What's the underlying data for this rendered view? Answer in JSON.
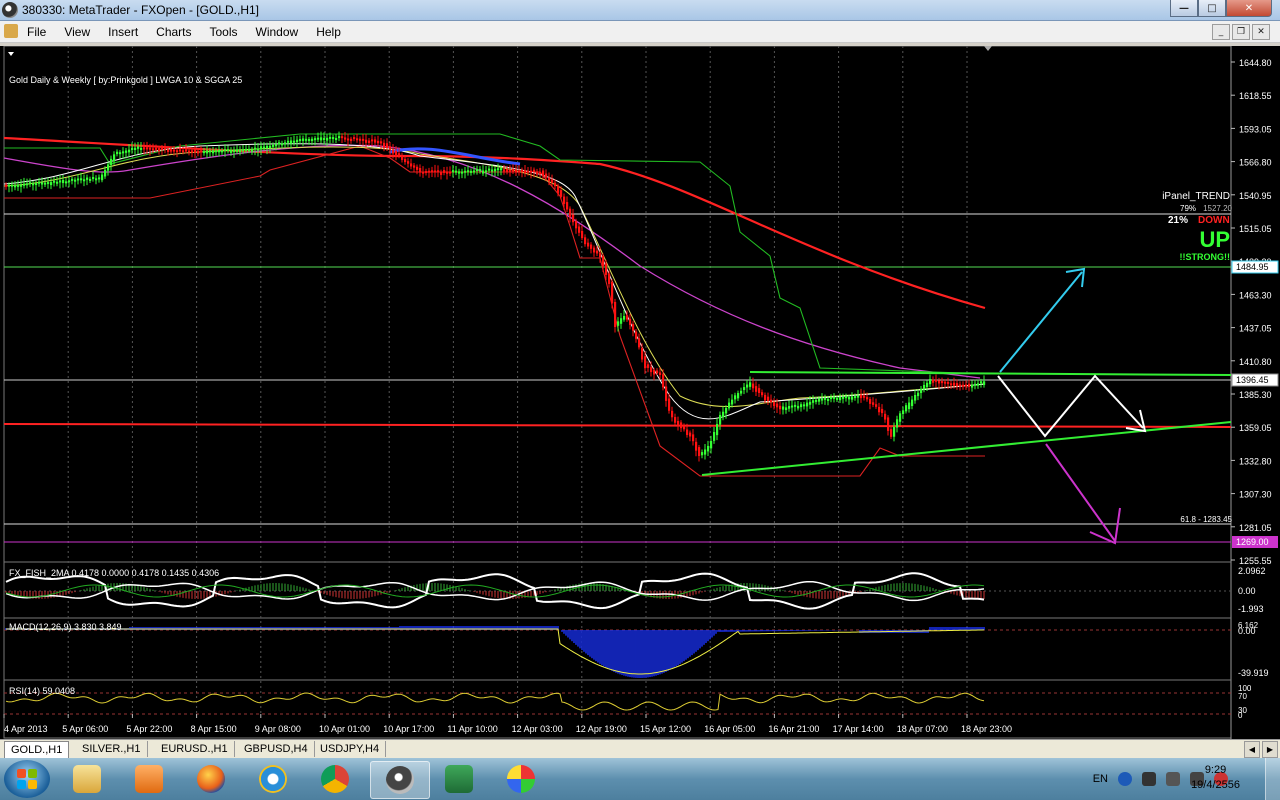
{
  "window": {
    "title": "380330: MetaTrader - FXOpen - [GOLD.,H1]",
    "min": "—",
    "max": "□",
    "close": "✕"
  },
  "menu": [
    "File",
    "View",
    "Insert",
    "Charts",
    "Tools",
    "Window",
    "Help"
  ],
  "mdi_buttons": [
    "_",
    "❐",
    "✕"
  ],
  "chart": {
    "header_label": "Gold Daily & Weekly [ by:Prinkgold ]  LWGA 10  &  SGGA 25",
    "panel": {
      "title": "iPanel_TREND",
      "up_pct": "79%",
      "down_pct": "21%",
      "down_label": "DOWN",
      "up_label": "UP",
      "strength": "!!STRONG!!",
      "range": "1527.20"
    },
    "fib_label": "61.8 - 1283.45",
    "price_ticks": [
      "1644.80",
      "1618.55",
      "1593.05",
      "1566.80",
      "1540.95",
      "1515.05",
      "1489.20",
      "1463.30",
      "1437.05",
      "1410.80",
      "1385.30",
      "1359.05",
      "1332.80",
      "1307.30",
      "1281.05",
      "1255.55"
    ],
    "price_tags": {
      "cyan": "1484.95",
      "white": "1396.45",
      "magenta": "1269.00"
    },
    "time_labels": [
      "4 Apr 2013",
      "5 Apr 06:00",
      "5 Apr 22:00",
      "8 Apr 15:00",
      "9 Apr 08:00",
      "10 Apr 01:00",
      "10 Apr 17:00",
      "11 Apr 10:00",
      "12 Apr 03:00",
      "12 Apr 19:00",
      "15 Apr 12:00",
      "16 Apr 05:00",
      "16 Apr 21:00",
      "17 Apr 14:00",
      "18 Apr 07:00",
      "18 Apr 23:00"
    ]
  },
  "indicators": {
    "fisher": {
      "label": "FX_FISH_2MA 0.4178 0.0000 0.4178 0.1435 0.4306",
      "ticks": [
        "2.0962",
        "0.00",
        "-1.993"
      ]
    },
    "macd": {
      "label": "MACD(12,26,9) 3.830 3.849",
      "ticks": [
        "6.162",
        "0.00",
        "-39.919"
      ]
    },
    "rsi": {
      "label": "RSI(14) 59.0408",
      "ticks": [
        "100",
        "70",
        "30",
        "0"
      ]
    }
  },
  "tabs": [
    "GOLD.,H1",
    "SILVER.,H1",
    "EURUSD.,H1",
    "GBPUSD,H4",
    "USDJPY,H4"
  ],
  "taskbar": {
    "apps": [
      "explorer",
      "media-player",
      "firefox",
      "internet-explorer",
      "chrome",
      "metatrader",
      "excel",
      "paint"
    ],
    "lang": "EN",
    "time": "9:29",
    "date": "19/4/2556"
  },
  "colors": {
    "bull": "#33ff33",
    "bear": "#ff1111",
    "cyan": "#33ccee",
    "magenta": "#cc33cc"
  }
}
